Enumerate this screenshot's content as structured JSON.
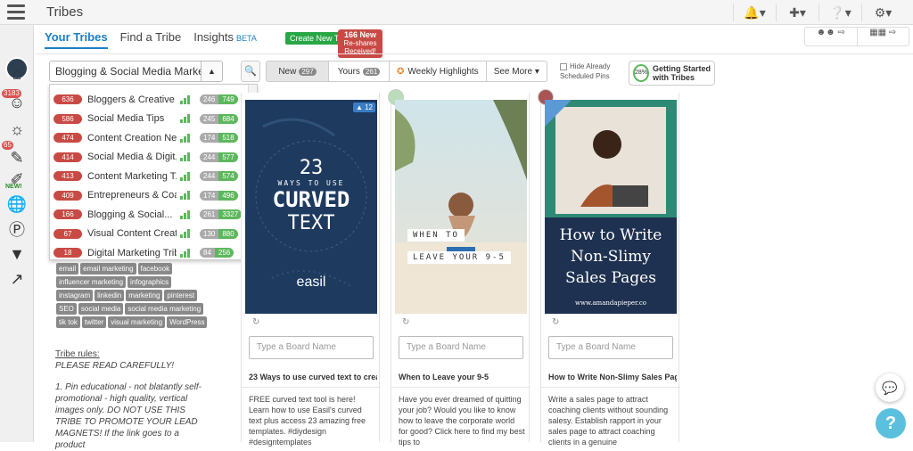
{
  "app": {
    "title": "Tribes"
  },
  "topbar": {
    "bell": "bell-icon",
    "plus": "plus-icon",
    "help": "help-icon",
    "gear": "gear-icon"
  },
  "leftnav": {
    "badge1": "3183",
    "badge2": "65",
    "new_label": "NEW!"
  },
  "tabs": [
    {
      "label": "Your Tribes"
    },
    {
      "label": "Find a Tribe"
    },
    {
      "label": "Insights"
    }
  ],
  "beta": "BETA",
  "create_button": "Create New Tribe",
  "new_bubble": {
    "count": "166 New",
    "line2": "Re-shares",
    "line3": "Received!"
  },
  "tribe_select": {
    "value": "Blogging & Social Media Marketing ..."
  },
  "dropdown": [
    {
      "count": "636",
      "name": "Bloggers & Creative ...",
      "a": "246",
      "b": "749"
    },
    {
      "count": "586",
      "name": "Social Media Tips",
      "a": "245",
      "b": "684"
    },
    {
      "count": "474",
      "name": "Content Creation Net...",
      "a": "174",
      "b": "518"
    },
    {
      "count": "414",
      "name": "Social Media & Digit...",
      "a": "244",
      "b": "577"
    },
    {
      "count": "413",
      "name": "Content Marketing T...",
      "a": "244",
      "b": "574"
    },
    {
      "count": "409",
      "name": "Entrepreneurs & Coa...",
      "a": "174",
      "b": "496"
    },
    {
      "count": "166",
      "name": "Blogging & Social...",
      "a": "261",
      "b": "3327"
    },
    {
      "count": "67",
      "name": "Visual Content Creat...",
      "a": "130",
      "b": "880"
    },
    {
      "count": "18",
      "name": "Digital Marketing Tribe",
      "a": "84",
      "b": "256"
    }
  ],
  "tags": [
    "email",
    "email marketing",
    "facebook",
    "influencer marketing",
    "infographics",
    "instagram",
    "linkedin",
    "marketing",
    "pinterest",
    "SEO",
    "social media",
    "social media marketing",
    "tik tok",
    "twitter",
    "visual marketing",
    "WordPress"
  ],
  "rules": {
    "title": "Tribe rules:",
    "body": "PLEASE READ CAREFULLY!",
    "item1": "1. Pin educational - not blatantly self-promotional - high quality, vertical images only. DO NOT USE THIS TRIBE TO PROMOTE YOUR LEAD MAGNETS! If the link goes to a product"
  },
  "filters": {
    "new_label": "New",
    "new_count": "297",
    "yours_label": "Yours",
    "yours_count": "261",
    "highlights_label": "Weekly Highlights",
    "more_label": "See More"
  },
  "already_scheduled": "Hide Already Scheduled Pins",
  "getting_started": {
    "pct": "28%",
    "label": "Getting Started with Tribes"
  },
  "board_placeholder": "Type a Board Name",
  "cards": [
    {
      "badge": "12",
      "img_line1": "23",
      "img_line2": "WAYS TO USE",
      "img_line3": "CURVED",
      "img_line4": "TEXT",
      "brand": "easil",
      "title": "23 Ways to use curved text to create",
      "desc": "FREE curved text tool is here! Learn how to use Easil's curved text plus access 23 amazing free templates. #diydesign #designtemplates"
    },
    {
      "img_line1": "WHEN TO",
      "img_line2": "LEAVE YOUR 9-5",
      "title": "When to Leave your 9-5",
      "desc": "Have you ever dreamed of quitting your job? Would you like to know how to leave the corporate world for good? Click here to find my best tips to"
    },
    {
      "img_line1": "How to Write",
      "img_line2": "Non-Slimy",
      "img_line3": "Sales Pages",
      "site": "www.amandapieper.co",
      "title": "How to Write Non-Slimy Sales Page",
      "desc": "Write a sales page to attract coaching clients without sounding salesy. Establish rapport in your sales page to attract coaching clients in a genuine"
    }
  ],
  "colors": {
    "accent": "#1a80c4",
    "red": "#c94a45",
    "green": "#5cb85c"
  }
}
